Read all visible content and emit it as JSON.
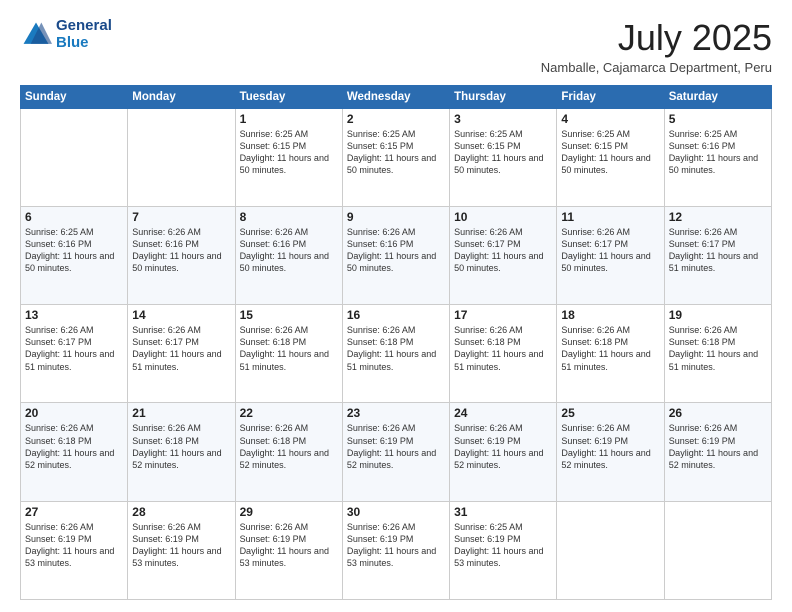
{
  "logo": {
    "line1": "General",
    "line2": "Blue"
  },
  "title": "July 2025",
  "location": "Namballe, Cajamarca Department, Peru",
  "days_of_week": [
    "Sunday",
    "Monday",
    "Tuesday",
    "Wednesday",
    "Thursday",
    "Friday",
    "Saturday"
  ],
  "weeks": [
    [
      {
        "day": "",
        "info": ""
      },
      {
        "day": "",
        "info": ""
      },
      {
        "day": "1",
        "info": "Sunrise: 6:25 AM\nSunset: 6:15 PM\nDaylight: 11 hours and 50 minutes."
      },
      {
        "day": "2",
        "info": "Sunrise: 6:25 AM\nSunset: 6:15 PM\nDaylight: 11 hours and 50 minutes."
      },
      {
        "day": "3",
        "info": "Sunrise: 6:25 AM\nSunset: 6:15 PM\nDaylight: 11 hours and 50 minutes."
      },
      {
        "day": "4",
        "info": "Sunrise: 6:25 AM\nSunset: 6:15 PM\nDaylight: 11 hours and 50 minutes."
      },
      {
        "day": "5",
        "info": "Sunrise: 6:25 AM\nSunset: 6:16 PM\nDaylight: 11 hours and 50 minutes."
      }
    ],
    [
      {
        "day": "6",
        "info": "Sunrise: 6:25 AM\nSunset: 6:16 PM\nDaylight: 11 hours and 50 minutes."
      },
      {
        "day": "7",
        "info": "Sunrise: 6:26 AM\nSunset: 6:16 PM\nDaylight: 11 hours and 50 minutes."
      },
      {
        "day": "8",
        "info": "Sunrise: 6:26 AM\nSunset: 6:16 PM\nDaylight: 11 hours and 50 minutes."
      },
      {
        "day": "9",
        "info": "Sunrise: 6:26 AM\nSunset: 6:16 PM\nDaylight: 11 hours and 50 minutes."
      },
      {
        "day": "10",
        "info": "Sunrise: 6:26 AM\nSunset: 6:17 PM\nDaylight: 11 hours and 50 minutes."
      },
      {
        "day": "11",
        "info": "Sunrise: 6:26 AM\nSunset: 6:17 PM\nDaylight: 11 hours and 50 minutes."
      },
      {
        "day": "12",
        "info": "Sunrise: 6:26 AM\nSunset: 6:17 PM\nDaylight: 11 hours and 51 minutes."
      }
    ],
    [
      {
        "day": "13",
        "info": "Sunrise: 6:26 AM\nSunset: 6:17 PM\nDaylight: 11 hours and 51 minutes."
      },
      {
        "day": "14",
        "info": "Sunrise: 6:26 AM\nSunset: 6:17 PM\nDaylight: 11 hours and 51 minutes."
      },
      {
        "day": "15",
        "info": "Sunrise: 6:26 AM\nSunset: 6:18 PM\nDaylight: 11 hours and 51 minutes."
      },
      {
        "day": "16",
        "info": "Sunrise: 6:26 AM\nSunset: 6:18 PM\nDaylight: 11 hours and 51 minutes."
      },
      {
        "day": "17",
        "info": "Sunrise: 6:26 AM\nSunset: 6:18 PM\nDaylight: 11 hours and 51 minutes."
      },
      {
        "day": "18",
        "info": "Sunrise: 6:26 AM\nSunset: 6:18 PM\nDaylight: 11 hours and 51 minutes."
      },
      {
        "day": "19",
        "info": "Sunrise: 6:26 AM\nSunset: 6:18 PM\nDaylight: 11 hours and 51 minutes."
      }
    ],
    [
      {
        "day": "20",
        "info": "Sunrise: 6:26 AM\nSunset: 6:18 PM\nDaylight: 11 hours and 52 minutes."
      },
      {
        "day": "21",
        "info": "Sunrise: 6:26 AM\nSunset: 6:18 PM\nDaylight: 11 hours and 52 minutes."
      },
      {
        "day": "22",
        "info": "Sunrise: 6:26 AM\nSunset: 6:18 PM\nDaylight: 11 hours and 52 minutes."
      },
      {
        "day": "23",
        "info": "Sunrise: 6:26 AM\nSunset: 6:19 PM\nDaylight: 11 hours and 52 minutes."
      },
      {
        "day": "24",
        "info": "Sunrise: 6:26 AM\nSunset: 6:19 PM\nDaylight: 11 hours and 52 minutes."
      },
      {
        "day": "25",
        "info": "Sunrise: 6:26 AM\nSunset: 6:19 PM\nDaylight: 11 hours and 52 minutes."
      },
      {
        "day": "26",
        "info": "Sunrise: 6:26 AM\nSunset: 6:19 PM\nDaylight: 11 hours and 52 minutes."
      }
    ],
    [
      {
        "day": "27",
        "info": "Sunrise: 6:26 AM\nSunset: 6:19 PM\nDaylight: 11 hours and 53 minutes."
      },
      {
        "day": "28",
        "info": "Sunrise: 6:26 AM\nSunset: 6:19 PM\nDaylight: 11 hours and 53 minutes."
      },
      {
        "day": "29",
        "info": "Sunrise: 6:26 AM\nSunset: 6:19 PM\nDaylight: 11 hours and 53 minutes."
      },
      {
        "day": "30",
        "info": "Sunrise: 6:26 AM\nSunset: 6:19 PM\nDaylight: 11 hours and 53 minutes."
      },
      {
        "day": "31",
        "info": "Sunrise: 6:25 AM\nSunset: 6:19 PM\nDaylight: 11 hours and 53 minutes."
      },
      {
        "day": "",
        "info": ""
      },
      {
        "day": "",
        "info": ""
      }
    ]
  ]
}
